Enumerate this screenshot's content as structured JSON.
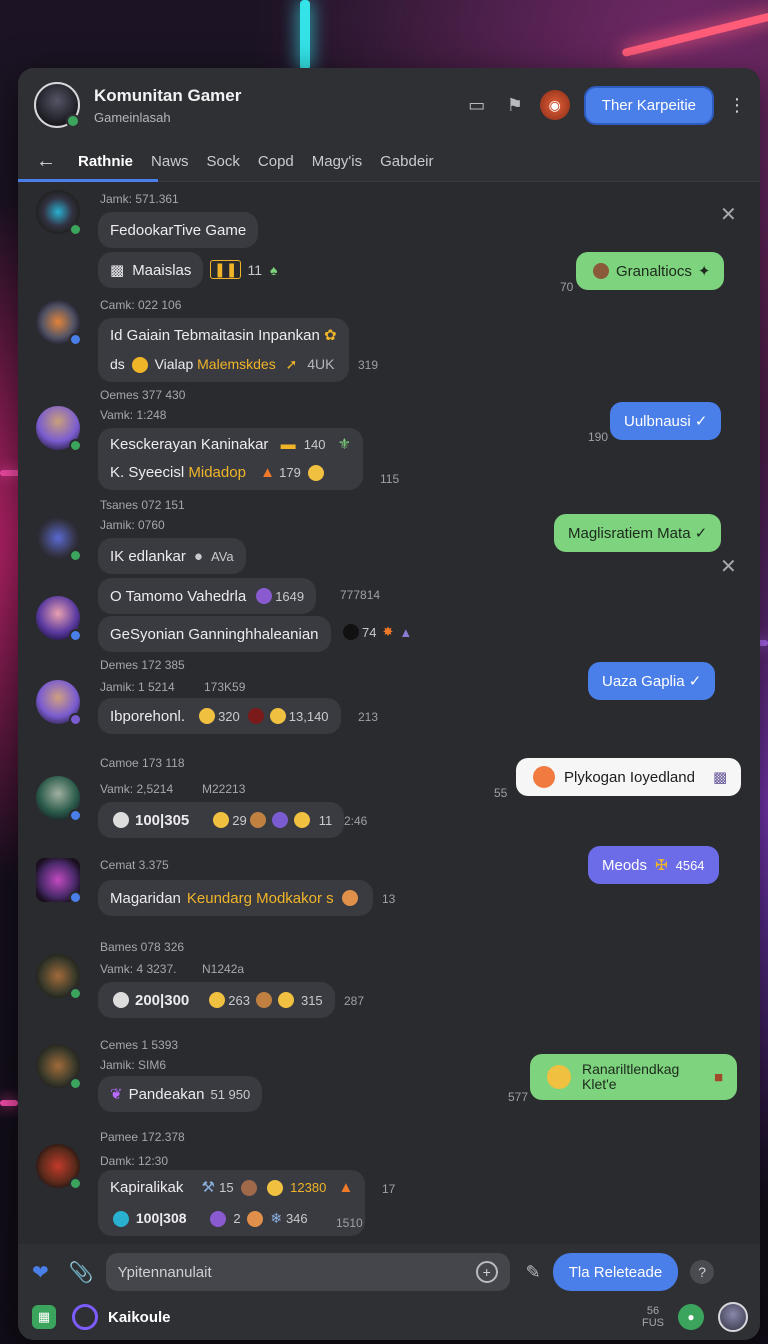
{
  "header": {
    "title": "Komunitan Gamer",
    "subtitle": "Gameinlasah",
    "primary_button": "Ther Karpeitie"
  },
  "tabs": [
    "Rathnie",
    "Naws",
    "Sock",
    "Copd",
    "Magy'is",
    "Gabdeir"
  ],
  "messages": {
    "m1": {
      "meta": "Jamk: 571.361",
      "line1": "FedookarTive Game",
      "line2": "Maaislas",
      "line2_extra": "11"
    },
    "m2": {
      "meta": "Camk: 022 106",
      "line1": "Id Gaiain Tebmaitasin Inpankan",
      "line2_a": "ds",
      "line2_b": "Vialap",
      "line2_hl": "Malemskdes",
      "line2_c": "4UK",
      "side": "319"
    },
    "m3": {
      "pre": "Oemes 377 430",
      "meta": "Vamk: 1:248",
      "line1": "Kesckerayan Kaninakar",
      "line1_num": "140",
      "line2_a": "K. Syeecisl",
      "line2_hl": "Midadop",
      "line2_num": "179",
      "side": "115"
    },
    "m4": {
      "pre": "Tsanes 072 151",
      "meta": "Jamik: 0760",
      "line1": "IK edlankar",
      "line1_b": "AVa"
    },
    "m5": {
      "line1": "O Tamomo Vahedrla",
      "line1_num": "1649",
      "side1": "777814",
      "line2": "GeSyonian Ganninghhaleanian",
      "line2_num": "74"
    },
    "m6": {
      "pre": "Demes 172 385",
      "meta": "Jamik: 1 5214",
      "meta2": "173K59",
      "line1": "Ibporehonl.",
      "n1": "320",
      "n2": "13,140",
      "side": "213"
    },
    "m7": {
      "pre": "Camoe 173 118",
      "meta": "Vamk: 2,5214",
      "meta2": "M22213",
      "line1": "100|305",
      "n1": "29",
      "n2": "11",
      "side": "2:46"
    },
    "m8": {
      "pre": "Cemat 3.375",
      "line1": "Magaridan",
      "line1_hl": "Keundarg Modkakor s",
      "side": "13"
    },
    "m9": {
      "pre": "Bames 078 326",
      "meta": "Vamk: 4 3237.",
      "meta2": "N1242a",
      "line1": "200|300",
      "n1": "263",
      "n2": "315",
      "side": "287"
    },
    "m10": {
      "pre": "Cemes 1 5393",
      "meta": "Jamik: SIM6",
      "line1": "Pandeakan",
      "line1_num": "51 950"
    },
    "m11": {
      "pre": "Pamee 172.378",
      "meta": "Damk: 12:30",
      "line1": "Kapiralikak",
      "n1": "15",
      "n2": "12380",
      "side1": "17",
      "line2": "100|308",
      "n3": "2",
      "n4": "346",
      "side2": "1510"
    }
  },
  "outgoing": {
    "o1": {
      "text": "Granaltiocs",
      "side": "70"
    },
    "o2": {
      "text": "Uulbnausi ✓",
      "side": "190"
    },
    "o3": {
      "text": "Maglisratiem Mata ✓"
    },
    "o4": {
      "text": "Uaza Gaplia ✓"
    },
    "o5": {
      "text": "Plykogan Ioyedland",
      "side": "55"
    },
    "o6": {
      "text": "Meods",
      "num": "4564"
    },
    "o7": {
      "text": "Ranariltlendkag Klet'e",
      "side": "577"
    }
  },
  "composer": {
    "placeholder": "Ypitennanulait",
    "send_button": "Tla Releteade",
    "bottom_label": "Kaikoule",
    "fps_value": "56",
    "fps_label": "FUS"
  },
  "colors": {
    "accent_blue": "#4a7ee8",
    "bubble_green": "#7ed37e",
    "highlight": "#f0b429",
    "online": "#3ba55d"
  }
}
